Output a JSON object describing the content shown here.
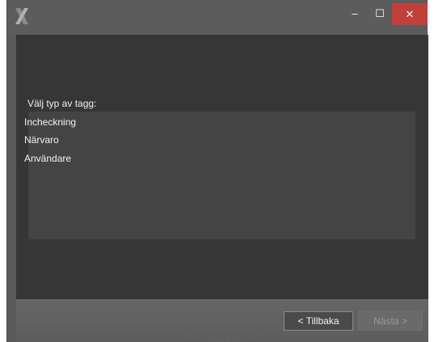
{
  "window": {
    "logo_icon": "x-logo-icon",
    "controls": {
      "minimize_glyph": "–",
      "maximize_glyph": "☐",
      "close_glyph": "✕",
      "close_color": "#c1403a"
    }
  },
  "main": {
    "prompt": "Välj typ av tagg:",
    "list_items": [
      "Incheckning",
      "Närvaro",
      "Användare"
    ]
  },
  "footer": {
    "back_label": "< Tillbaka",
    "next_label": "Nästa >",
    "next_enabled": false
  },
  "colors": {
    "window_frame": "#5a5a5a",
    "content_bg": "#363636",
    "list_bg": "#444444",
    "text": "#f2f2f2"
  }
}
